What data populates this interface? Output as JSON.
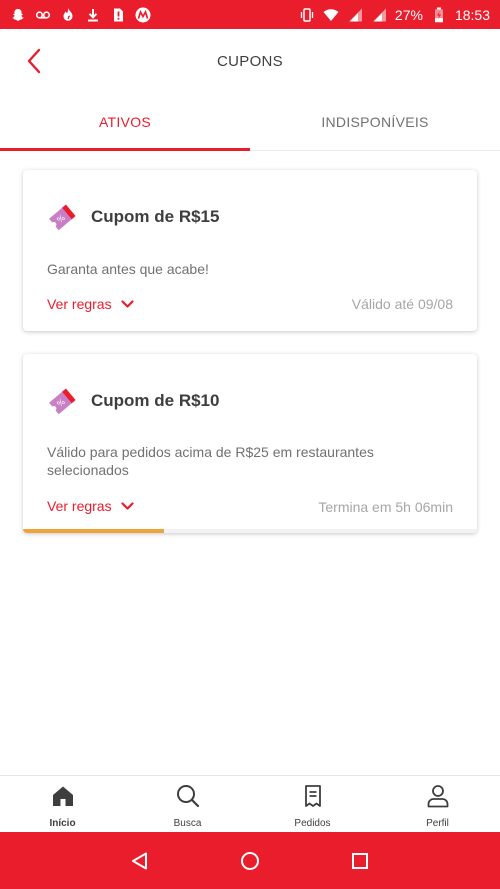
{
  "status_bar": {
    "battery": "27%",
    "time": "18:53",
    "left_icons": [
      "snapchat-icon",
      "voicemail-icon",
      "fire-icon",
      "download-icon",
      "sim-alert-icon",
      "motorola-icon"
    ],
    "right_icons": [
      "vibrate-icon",
      "wifi-icon",
      "signal-icon",
      "signal-icon",
      "battery-charging-icon"
    ]
  },
  "header": {
    "title": "CUPONS",
    "back_icon": "chevron-left-icon"
  },
  "tabs": [
    {
      "label": "ATIVOS",
      "active": true
    },
    {
      "label": "INDISPONÍVEIS",
      "active": false
    }
  ],
  "coupons": [
    {
      "title": "Cupom de R$15",
      "description": "Garanta antes que acabe!",
      "rules_label": "Ver regras",
      "validity": "Válido até 09/08"
    },
    {
      "title": "Cupom de R$10",
      "description": "Válido para pedidos acima de R$25 em restaurantes selecionados",
      "rules_label": "Ver regras",
      "validity": "Termina em 5h 06min",
      "progress": 0.31
    }
  ],
  "bottom_nav": [
    {
      "label": "Início",
      "icon": "home-icon",
      "active": true
    },
    {
      "label": "Busca",
      "icon": "search-icon",
      "active": false
    },
    {
      "label": "Pedidos",
      "icon": "receipt-icon",
      "active": false
    },
    {
      "label": "Perfil",
      "icon": "person-icon",
      "active": false
    }
  ],
  "colors": {
    "brand_red": "#ea1d2c",
    "text_dark": "#3f3e3e",
    "text_muted": "#717171",
    "text_light": "#a6a6a6",
    "progress_orange": "#f0a33a",
    "coupon_icon_pink": "#c97fc6"
  }
}
